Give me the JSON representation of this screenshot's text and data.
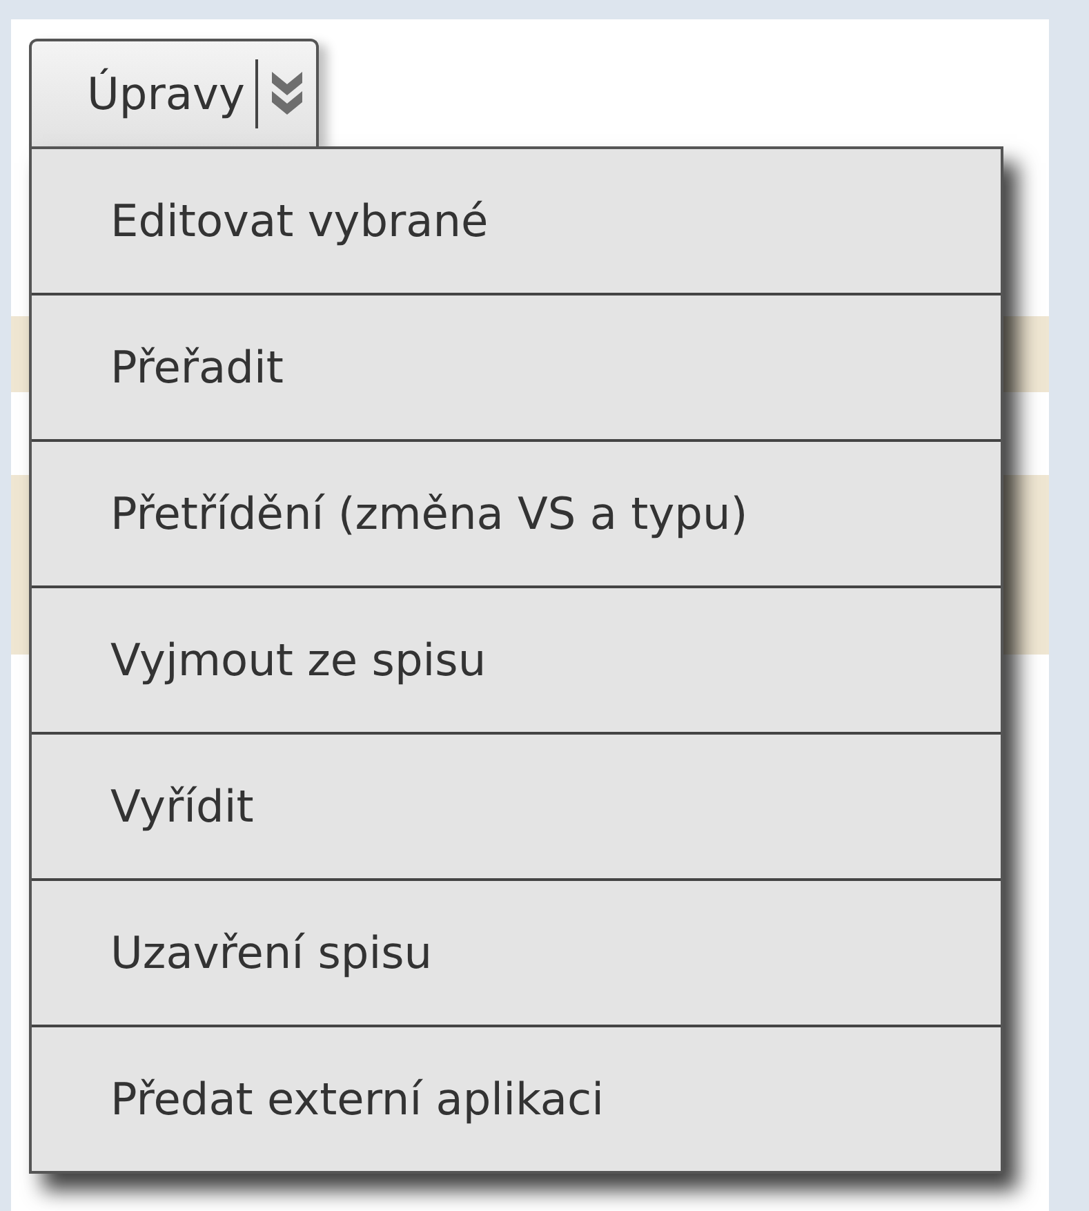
{
  "menu_button": {
    "label": "Úpravy"
  },
  "menu": {
    "items": [
      {
        "label": "Editovat vybrané"
      },
      {
        "label": "Přeřadit"
      },
      {
        "label": "Přetřídění (změna VS a typu)"
      },
      {
        "label": "Vyjmout ze spisu"
      },
      {
        "label": "Vyřídit"
      },
      {
        "label": "Uzavření spisu"
      },
      {
        "label": "Předat externí aplikaci"
      }
    ]
  }
}
